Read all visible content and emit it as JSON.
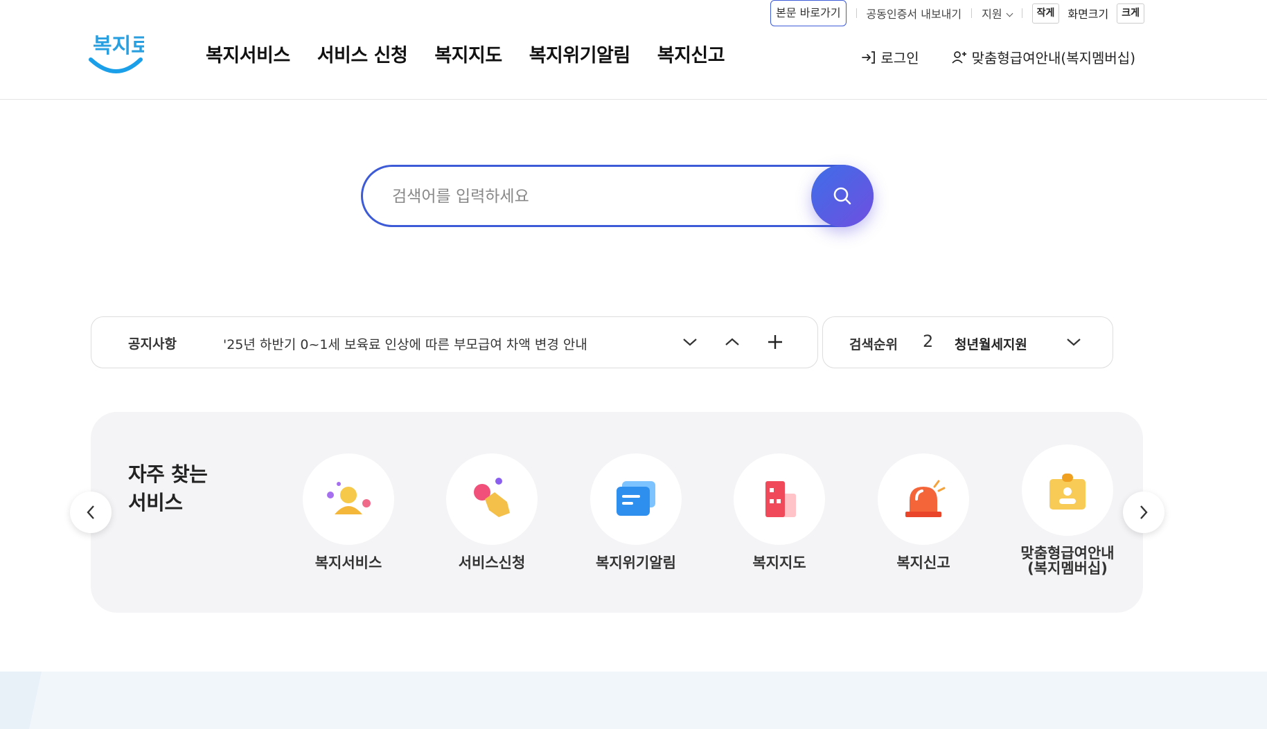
{
  "util": {
    "skip": "본문 바로가기",
    "cert": "공동인증서 내보내기",
    "support": "지원",
    "small": "작게",
    "screen_size": "화면크기",
    "large": "크게"
  },
  "brand": {
    "logo_text": "복지로"
  },
  "gnb": {
    "items": [
      "복지서비스",
      "서비스 신청",
      "복지지도",
      "복지위기알림",
      "복지신고"
    ]
  },
  "header_right": {
    "login": "로그인",
    "membership": "맞춤형급여안내(복지멤버십)"
  },
  "search": {
    "placeholder": "검색어를 입력하세요"
  },
  "notice": {
    "label": "공지사항",
    "text": "'25년 하반기 0~1세 보육료 인상에 따른 부모급여 차액 변경 안내"
  },
  "rank": {
    "label": "검색순위",
    "number": "2",
    "word": "청년월세지원"
  },
  "frequent": {
    "title_line1": "자주 찾는",
    "title_line2": "서비스",
    "items": [
      {
        "label": "복지서비스",
        "icon": "welfare-person-icon"
      },
      {
        "label": "서비스신청",
        "icon": "tap-hand-icon"
      },
      {
        "label": "복지위기알림",
        "icon": "message-icon"
      },
      {
        "label": "복지지도",
        "icon": "map-building-icon"
      },
      {
        "label": "복지신고",
        "icon": "siren-icon"
      },
      {
        "label_line1": "맞춤형급여안내",
        "label_line2": "(복지멤버십)",
        "icon": "id-card-icon"
      }
    ]
  },
  "colors": {
    "accent": "#3d5bd6",
    "search_gradient_start": "#3e6ee8",
    "search_gradient_end": "#6f4fe0",
    "panel_bg": "#f4f4f6"
  }
}
